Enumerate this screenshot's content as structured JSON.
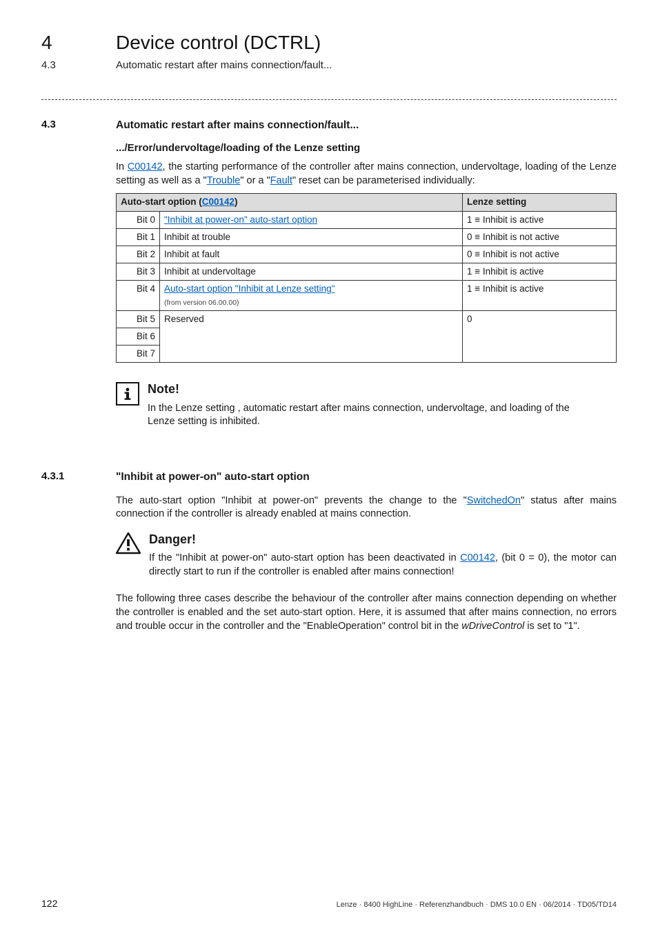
{
  "header": {
    "chapter_number": "4",
    "chapter_title": "Device control (DCTRL)",
    "section_number": "4.3",
    "section_title": "Automatic restart after mains connection/fault..."
  },
  "section": {
    "num": "4.3",
    "heading": "Automatic restart after mains connection/fault...",
    "subheading": ".../Error/undervoltage/loading of the Lenze setting",
    "intro_1": "In ",
    "intro_link1": "C00142",
    "intro_2": ", the starting performance of the controller after mains connection, undervoltage, loading of the Lenze setting as well as a \"",
    "intro_link2": "Trouble",
    "intro_3": "\" or a \"",
    "intro_link3": "Fault",
    "intro_4": "\" reset can be parameterised individually:"
  },
  "table": {
    "header_main_prefix": "Auto-start option (",
    "header_main_link": "C00142",
    "header_main_suffix": ")",
    "header_lenze": "Lenze setting",
    "rows": [
      {
        "bit": "Bit 0",
        "text_link": "\"Inhibit at power-on\" auto-start option",
        "lenze": "1 ≡ Inhibit is active"
      },
      {
        "bit": "Bit 1",
        "text": "Inhibit at trouble",
        "lenze": "0 ≡ Inhibit is not active"
      },
      {
        "bit": "Bit 2",
        "text": "Inhibit at fault",
        "lenze": "0 ≡ Inhibit is not active"
      },
      {
        "bit": "Bit 3",
        "text": "Inhibit at undervoltage",
        "lenze": "1 ≡ Inhibit is active"
      },
      {
        "bit": "Bit 4",
        "text_link": "Auto-start option \"Inhibit at Lenze setting\"",
        "subtext": "(from version 06.00.00)",
        "lenze": "1 ≡ Inhibit is active"
      },
      {
        "bit": "Bit 5",
        "text": "Reserved",
        "lenze": "0"
      },
      {
        "bit": "Bit 6"
      },
      {
        "bit": "Bit 7"
      }
    ]
  },
  "note": {
    "title": "Note!",
    "text": "In the Lenze setting , automatic restart after mains connection, undervoltage, and loading of the Lenze setting is inhibited."
  },
  "subsection": {
    "num": "4.3.1",
    "heading": "\"Inhibit at power-on\" auto-start option",
    "para1_a": "The auto-start option \"Inhibit at power-on\" prevents the change to the \"",
    "para1_link": "SwitchedOn",
    "para1_b": "\" status after mains connection if the controller is already enabled at mains connection."
  },
  "danger": {
    "title": "Danger!",
    "text_a": "If the  \"Inhibit at power-on\" auto-start option has been deactivated in ",
    "text_link": "C00142",
    "text_b": ", (bit 0 = 0), the motor can directly start to run if the controller is enabled after mains connection!"
  },
  "tail_para_a": "The following three cases describe the behaviour of the controller after mains connection depending on whether the controller is enabled and the set auto-start option. Here, it is assumed that after mains connection, no errors and trouble occur in the controller and the \"EnableOperation\" control bit in the ",
  "tail_para_italic": "wDriveControl",
  "tail_para_b": " is set to \"1\".",
  "footer": {
    "page": "122",
    "imprint": "Lenze · 8400 HighLine · Referenzhandbuch · DMS 10.0 EN · 06/2014 · TD05/TD14"
  }
}
